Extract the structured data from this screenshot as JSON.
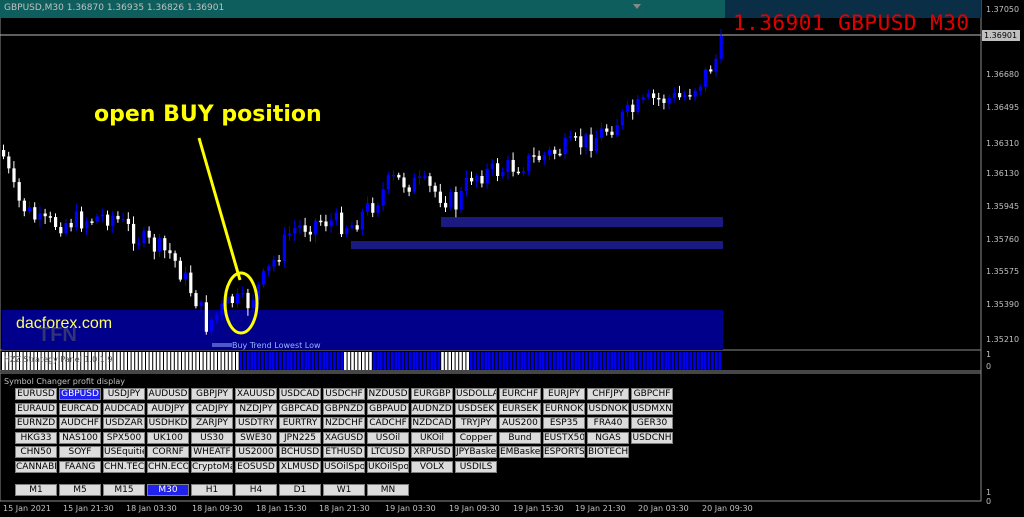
{
  "header": {
    "text": "GBPUSD,M30  1.36870 1.36935 1.36826 1.36901"
  },
  "big_price": "1.36901 GBPUSD M30",
  "annotation": "open BUY position",
  "watermark": "dacforex.com",
  "logo_text": "TFN",
  "indicator_label": "Buy Trend Lowest  Low",
  "subwindow_label": "HZZ Strategy Panel 1.0.1.9",
  "panel_title": "Symbol Changer profit display",
  "current_price": "1.36901",
  "y_axis": [
    "1.37050",
    "1.36901",
    "1.36680",
    "1.36495",
    "1.36310",
    "1.36130",
    "1.35945",
    "1.35760",
    "1.35575",
    "1.35390",
    "1.35210"
  ],
  "sub_axis": [
    "1",
    "0",
    "1",
    "0"
  ],
  "x_axis": [
    "15 Jan 2021",
    "15 Jan 21:30",
    "18 Jan 03:30",
    "18 Jan 09:30",
    "18 Jan 15:30",
    "18 Jan 21:30",
    "19 Jan 03:30",
    "19 Jan 09:30",
    "19 Jan 15:30",
    "19 Jan 21:30",
    "20 Jan 03:30",
    "20 Jan 09:30"
  ],
  "symbols": [
    [
      "EURUSD",
      "GBPUSD",
      "USDJPY",
      "AUDUSD",
      "GBPJPY",
      "XAUUSD",
      "USDCAD",
      "USDCHF",
      "NZDUSD",
      "EURGBP",
      "USDOLLAR",
      "EURCHF",
      "EURJPY",
      "CHFJPY",
      "GBPCHF"
    ],
    [
      "EURAUD",
      "EURCAD",
      "AUDCAD",
      "AUDJPY",
      "CADJPY",
      "NZDJPY",
      "GBPCAD",
      "GBPNZD",
      "GBPAUD",
      "AUDNZD",
      "USDSEK",
      "EURSEK",
      "EURNOK",
      "USDNOK",
      "USDMXN"
    ],
    [
      "EURNZD",
      "AUDCHF",
      "USDZAR",
      "USDHKD",
      "ZARJPY",
      "USDTRY",
      "EURTRY",
      "NZDCHF",
      "CADCHF",
      "NZDCAD",
      "TRYJPY",
      "AUS200",
      "ESP35",
      "FRA40",
      "GER30"
    ],
    [
      "HKG33",
      "NAS100",
      "SPX500",
      "UK100",
      "US30",
      "SWE30",
      "JPN225",
      "XAGUSD",
      "USOil",
      "UKOil",
      "Copper",
      "Bund",
      "EUSTX50",
      "NGAS",
      "USDCNH"
    ],
    [
      "CHN50",
      "SOYF",
      "USEquities",
      "CORNF",
      "WHEATF",
      "US2000",
      "BCHUSD",
      "ETHUSD",
      "LTCUSD",
      "XRPUSD",
      "JPYBasket",
      "EMBasket",
      "ESPORTS",
      "BIOTECH"
    ],
    [
      "CANNABIS",
      "FAANG",
      "CHN.TECH",
      "CHN.ECOMM",
      "CryptoMajor",
      "EOSUSD",
      "XLMUSD",
      "USOilSpot",
      "UKOilSpot",
      "VOLX",
      "USDILS"
    ]
  ],
  "selected_symbol": "GBPUSD",
  "timeframes": [
    "M1",
    "M5",
    "M15",
    "M30",
    "H1",
    "H4",
    "D1",
    "W1",
    "MN"
  ],
  "selected_timeframe": "M30",
  "colors": {
    "bull": "#0000ff",
    "bear": "#ffffff",
    "zone": "#00008b",
    "annotation": "#ffff00",
    "price": "#e00000",
    "selected": "#2222ee"
  }
}
